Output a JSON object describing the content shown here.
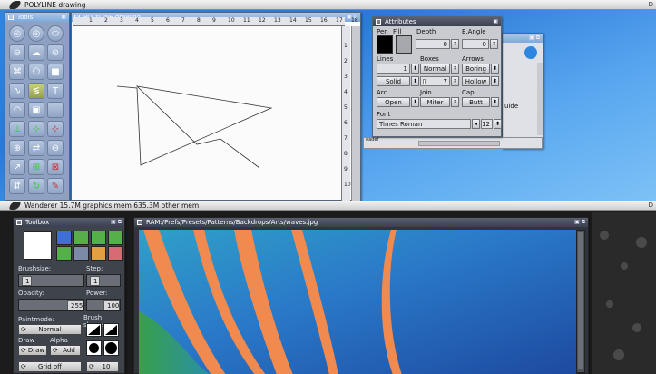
{
  "top": {
    "title": "POLYLINE drawing",
    "right_edge": "D"
  },
  "tools_window": {
    "title": "Tools"
  },
  "drawing_window": {
    "title": "POLYLINE drawing",
    "ruler_h": [
      "1",
      "2",
      "3",
      "4",
      "5",
      "6",
      "7",
      "8",
      "9",
      "10",
      "11",
      "12",
      "13",
      "14",
      "15",
      "16",
      "17",
      "18"
    ],
    "ruler_v": [
      "1",
      "2",
      "3",
      "4",
      "5",
      "6",
      "7",
      "8",
      "9",
      "10"
    ]
  },
  "attributes": {
    "title": "Attributes",
    "pen_label": "Pen",
    "fill_label": "Fill",
    "depth_label": "Depth",
    "depth_value": "0",
    "angle_label": "E.Angle",
    "angle_value": "0",
    "lines_label": "Lines",
    "lines_value": "1",
    "boxes_label": "Boxes",
    "boxes_value": "Normal",
    "arrows_label": "Arrows",
    "arrows_value": "Boring",
    "line_style": "Solid",
    "box_width": "7",
    "arrow_style": "Hollow",
    "arc_label": "Arc",
    "arc_value": "Open",
    "join_label": "Join",
    "join_value": "Miter",
    "cap_label": "Cap",
    "cap_value": "Butt",
    "font_label": "Font",
    "font_value": "Times Roman",
    "font_size": "12",
    "pen_color": "#000000",
    "fill_color": "#a6a8ad"
  },
  "behind_window": {
    "side_text": "uide",
    "bottom_text": "eadef"
  },
  "bottom": {
    "title": "Wanderer 15.7M graphics mem 635.3M other mem",
    "right_edge": "D",
    "toolbox": {
      "title": "Toolbox",
      "brushsize_label": "Brushsize:",
      "brushsize_value": "1",
      "step_label": "Step:",
      "step_value": "1",
      "opacity_label": "Opacity:",
      "opacity_value": "255",
      "power_label": "Power:",
      "power_value": "100",
      "paintmode_label": "Paintmode:",
      "paintmode_value": "Normal",
      "brushshape_label": "Brush shape:",
      "draw_label": "Draw",
      "alpha_label": "Alpha",
      "draw_value": "Draw",
      "alpha_value": "Add",
      "grid_value": "Grid off",
      "grid_size": "10"
    },
    "image_window": {
      "title": "RAM:/Prefs/Presets/Patterns/Backdrops/Arts/waves.jpg"
    }
  }
}
